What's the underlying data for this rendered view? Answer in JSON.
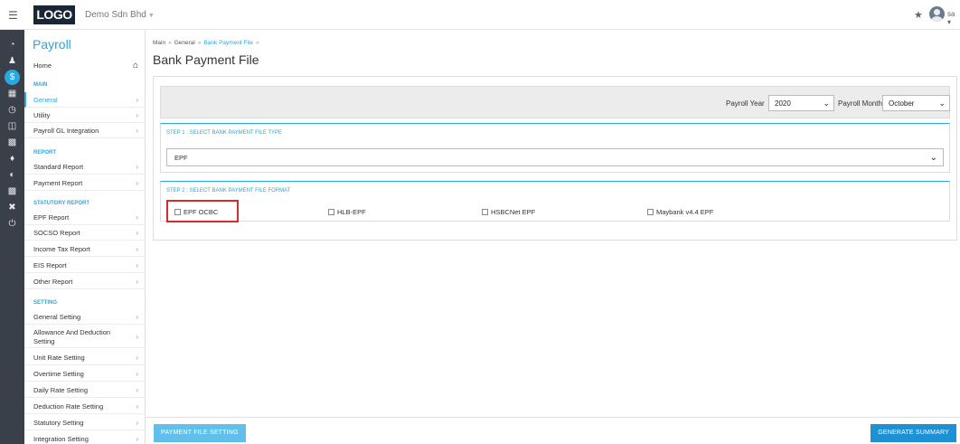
{
  "header": {
    "logo": "LOGO",
    "company": "Demo Sdn Bhd",
    "user": "sa"
  },
  "sidebar": {
    "title": "Payroll",
    "home": "Home",
    "sections": {
      "main": "MAIN",
      "report": "REPORT",
      "statutory": "STATUTORY REPORT",
      "setting": "SETTING"
    },
    "main_items": [
      "General",
      "Utility",
      "Payroll GL Integration"
    ],
    "report_items": [
      "Standard Report",
      "Payment Report"
    ],
    "statutory_items": [
      "EPF Report",
      "SOCSO Report",
      "Income Tax Report",
      "EIS Report",
      "Other Report"
    ],
    "setting_items": [
      "General Setting",
      "Allowance And Deduction Setting",
      "Unit Rate Setting",
      "Overtime Setting",
      "Daily Rate Setting",
      "Deduction Rate Setting",
      "Statutory Setting",
      "Integration Setting"
    ]
  },
  "breadcrumb": {
    "main": "Main",
    "general": "General",
    "current": "Bank Payment File"
  },
  "page_title": "Bank Payment File",
  "filters": {
    "year_label": "Payroll Year",
    "year_value": "2020",
    "month_label": "Payroll Month",
    "month_value": "October"
  },
  "step1": {
    "title": "STEP 1 : SELECT BANK PAYMENT FILE TYPE",
    "value": "EPF"
  },
  "step2": {
    "title": "STEP 2 : SELECT BANK PAYMENT FILE FORMAT",
    "options": [
      "EPF OCBC",
      "HLB-EPF",
      "HSBCNet EPF",
      "Maybank v4.4 EPF"
    ]
  },
  "buttons": {
    "payment_file_setting": "PAYMENT FILE SETTING",
    "generate_summary": "GENERATE SUMMARY"
  },
  "colors": {
    "accent": "#2aa7e0",
    "rail": "#3a4049",
    "highlight": "#d42c2c"
  }
}
